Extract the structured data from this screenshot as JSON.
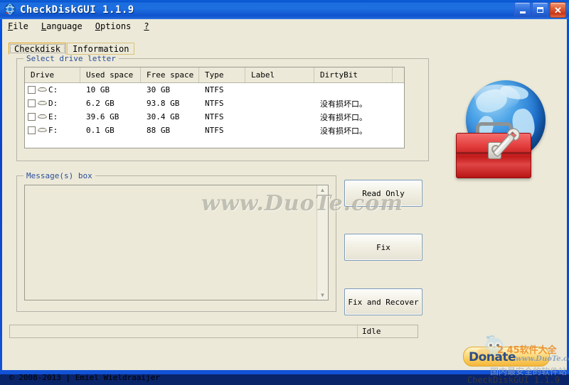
{
  "window": {
    "title": "CheckDiskGUI 1.1.9",
    "icon": "globe-icon",
    "minimize_label": "",
    "maximize_label": "",
    "close_label": "✕",
    "titlebar_color": "#1B6EE0",
    "client_color": "#ECE9D8"
  },
  "menu": [
    {
      "label": "File",
      "accel": "F"
    },
    {
      "label": "Language",
      "accel": "L"
    },
    {
      "label": "Options",
      "accel": "O"
    },
    {
      "label": "?",
      "accel": "?"
    }
  ],
  "tabs": [
    {
      "label": "Checkdisk",
      "active": true
    },
    {
      "label": "Information",
      "active": false
    }
  ],
  "drive_group": {
    "label": "Select drive letter",
    "columns": [
      "Drive",
      "Used space",
      "Free space",
      "Type",
      "Label",
      "DirtyBit"
    ],
    "rows": [
      {
        "drive": "C:",
        "used": "10 GB",
        "free": "30 GB",
        "type": "NTFS",
        "label": "",
        "dirtybit": ""
      },
      {
        "drive": "D:",
        "used": "6.2 GB",
        "free": "93.8 GB",
        "type": "NTFS",
        "label": "",
        "dirtybit": "没有损坏口。"
      },
      {
        "drive": "E:",
        "used": "39.6 GB",
        "free": "30.4 GB",
        "type": "NTFS",
        "label": "",
        "dirtybit": "没有损坏口。"
      },
      {
        "drive": "F:",
        "used": "0.1 GB",
        "free": "88 GB",
        "type": "NTFS",
        "label": "",
        "dirtybit": "没有损坏口。"
      }
    ]
  },
  "message_group": {
    "label": "Message(s) box",
    "text": "",
    "scroll_up": "▲",
    "scroll_down": "▼"
  },
  "buttons": {
    "read_only": "Read Only",
    "fix": "Fix",
    "fix_and_recover": "Fix and Recover"
  },
  "statusbar": {
    "left": "",
    "right": "Idle"
  },
  "copyright": "© 2008-2013 | Emiel Wieldraaijer",
  "logo": {
    "name": "globe-toolbox-icon",
    "globe_color": "#1C6FD0",
    "toolbox_color": "#C21B1B"
  },
  "watermarks": {
    "center": "www.DuoTe.com",
    "donate": "Donate",
    "site_245": "2 45软件大全",
    "duote_small": "www.DuoTe.com",
    "cn_tagline": "国内最安全的软件站",
    "version": "CheckDiskGUI 1.1.9"
  }
}
